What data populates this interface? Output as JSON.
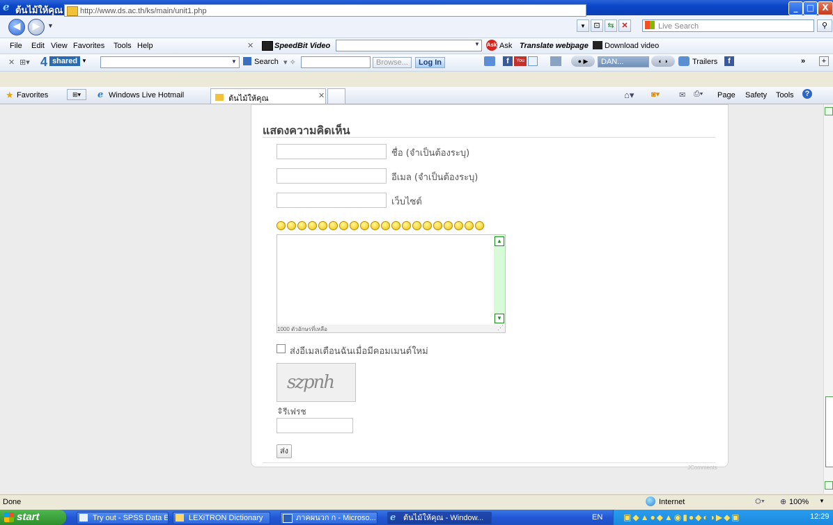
{
  "window": {
    "title": "ต้นไม้ให้คุณ - Windows Internet Explorer",
    "min": "_",
    "max": "□",
    "close": "X"
  },
  "address": {
    "url": "http://www.ds.ac.th/ks/main/unit1.php",
    "search_placeholder": "Live Search"
  },
  "menu": [
    "File",
    "Edit",
    "View",
    "Favorites",
    "Tools",
    "Help"
  ],
  "speedbit": {
    "label": "SpeedBit Video",
    "ask": "Ask",
    "translate": "Translate webpage",
    "download": "Download video"
  },
  "fourshared": {
    "four": "4",
    "brand": "shared",
    "search": "Search",
    "browse": "Browse...",
    "login": "Log In",
    "dan": "DAN...",
    "trailers": "Trailers"
  },
  "favbar": {
    "favorites": "Favorites",
    "hotmail": "Windows Live Hotmail",
    "tab_title": "ต้นไม้ให้คุณ",
    "page": "Page",
    "safety": "Safety",
    "tools": "Tools"
  },
  "form": {
    "heading": "แสดงความคิดเห็น",
    "name_label": "ชื่อ (จำเป็นต้องระบุ)",
    "email_label": "อีเมล (จำเป็นต้องระบุ)",
    "website_label": "เว็บไซต์",
    "chars_left": "1000 ตัวอักษรที่เหลือ",
    "notify_label": "ส่งอีเมลเตือนฉันเมื่อมีคอมเมนต์ใหม่",
    "captcha_text": "szpnh",
    "refresh": "รีเฟรช",
    "submit": "ส่ง",
    "footer": "JComments"
  },
  "status": {
    "done": "Done",
    "zone": "Internet",
    "zoom": "100%"
  },
  "taskbar": {
    "start": "start",
    "items": [
      "Try out - SPSS Data E...",
      "LEXiTRON Dictionary",
      "ภาคผนวก ก - Microso...",
      "ต้นไม้ให้คุณ - Window..."
    ],
    "lang": "EN",
    "clock": "12:29"
  }
}
